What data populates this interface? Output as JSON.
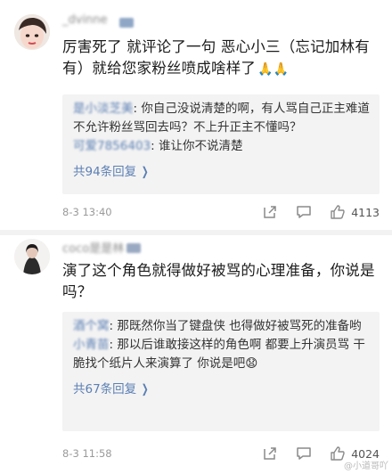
{
  "comments": [
    {
      "username": "_dvinne",
      "text": "厉害死了 就评论了一句 恶心小三（忘记加林有有）就给您家粉丝喷成啥样了",
      "emoji": "🙏🙏",
      "replies": [
        {
          "name": "是小淡芝美",
          "text": "你自己没说清楚的啊，有人骂自己正主难道不允许粉丝骂回去吗？不上升正主不懂吗？"
        },
        {
          "name": "可爱7856403",
          "text": "谁让你不说清楚"
        }
      ],
      "more_replies": "共94条回复",
      "time": "8-3 13:40",
      "likes": "4113"
    },
    {
      "username": "coco是是林",
      "text": "演了这个角色就得做好被骂的心理准备，你说是吗？",
      "emoji": "",
      "replies": [
        {
          "name": "酒个窝",
          "text": "那既然你当了键盘侠 也得做好被骂死的准备哟"
        },
        {
          "name": "小青苗",
          "text": "那以后谁敢接这样的角色啊 都要上升演员骂 干脆找个纸片人来演算了 你说是吧😧"
        }
      ],
      "more_replies": "共67条回复",
      "time": "8-3 11:58",
      "likes": "4024"
    }
  ],
  "watermark": "@小道哥吖",
  "icons": {
    "more": "chevron-right-icon",
    "share": "share-icon",
    "comment": "comment-icon",
    "like": "thumbs-up-icon"
  },
  "colors": {
    "link": "#5b7fb4",
    "reply_bg": "#f3f3f3",
    "meta": "#9a9a9a"
  }
}
